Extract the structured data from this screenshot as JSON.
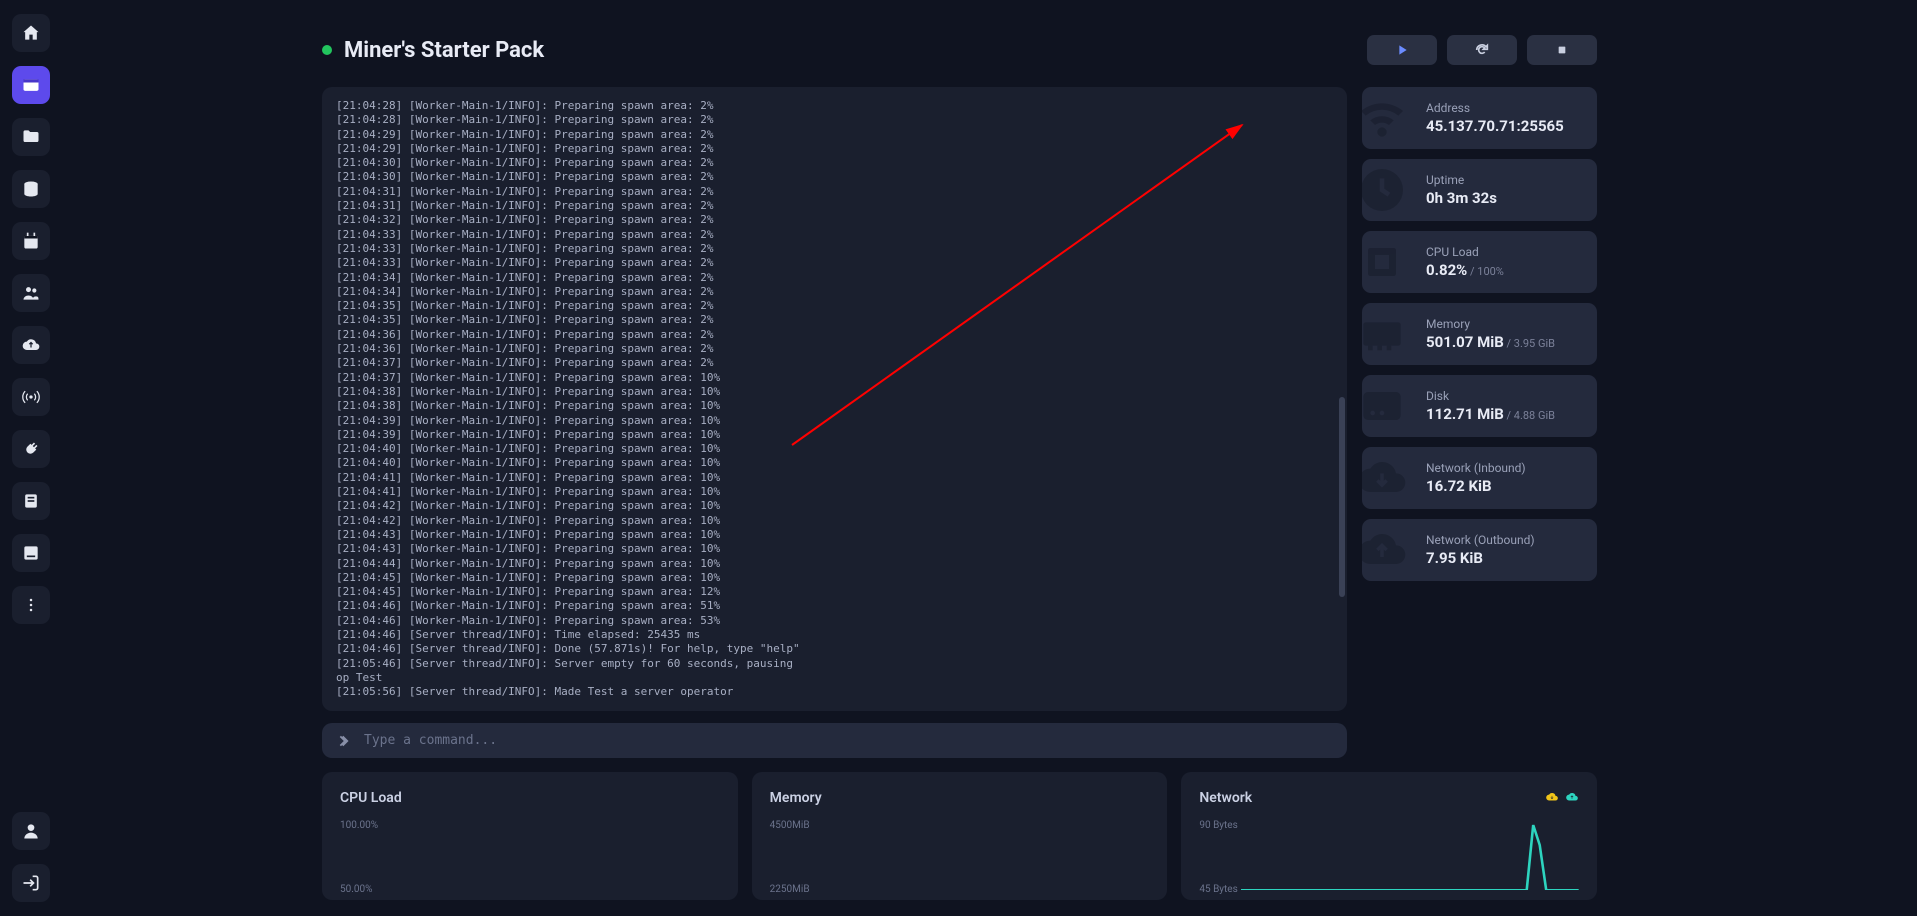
{
  "server": {
    "title": "Miner's Starter Pack",
    "status": "online"
  },
  "command": {
    "placeholder": "Type a command..."
  },
  "stats": [
    {
      "label": "Address",
      "value": "45.137.70.71:25565",
      "sub": ""
    },
    {
      "label": "Uptime",
      "value": "0h 3m 32s",
      "sub": ""
    },
    {
      "label": "CPU Load",
      "value": "0.82%",
      "sub": " / 100%"
    },
    {
      "label": "Memory",
      "value": "501.07 MiB",
      "sub": " / 3.95 GiB"
    },
    {
      "label": "Disk",
      "value": "112.71 MiB",
      "sub": " / 4.88 GiB"
    },
    {
      "label": "Network (Inbound)",
      "value": "16.72 KiB",
      "sub": ""
    },
    {
      "label": "Network (Outbound)",
      "value": "7.95 KiB",
      "sub": ""
    }
  ],
  "charts": {
    "cpu": {
      "title": "CPU Load",
      "tick_top": "100.00%",
      "tick_bot": "50.00%"
    },
    "mem": {
      "title": "Memory",
      "tick_top": "4500MiB",
      "tick_bot": "2250MiB"
    },
    "net": {
      "title": "Network",
      "tick_top": "90 Bytes",
      "tick_bot": "45 Bytes"
    }
  },
  "console_lines": [
    "[21:04:28] [Worker-Main-1/INFO]: Preparing spawn area: 2%",
    "[21:04:28] [Worker-Main-1/INFO]: Preparing spawn area: 2%",
    "[21:04:29] [Worker-Main-1/INFO]: Preparing spawn area: 2%",
    "[21:04:29] [Worker-Main-1/INFO]: Preparing spawn area: 2%",
    "[21:04:30] [Worker-Main-1/INFO]: Preparing spawn area: 2%",
    "[21:04:30] [Worker-Main-1/INFO]: Preparing spawn area: 2%",
    "[21:04:31] [Worker-Main-1/INFO]: Preparing spawn area: 2%",
    "[21:04:31] [Worker-Main-1/INFO]: Preparing spawn area: 2%",
    "[21:04:32] [Worker-Main-1/INFO]: Preparing spawn area: 2%",
    "[21:04:33] [Worker-Main-1/INFO]: Preparing spawn area: 2%",
    "[21:04:33] [Worker-Main-1/INFO]: Preparing spawn area: 2%",
    "[21:04:33] [Worker-Main-1/INFO]: Preparing spawn area: 2%",
    "[21:04:34] [Worker-Main-1/INFO]: Preparing spawn area: 2%",
    "[21:04:34] [Worker-Main-1/INFO]: Preparing spawn area: 2%",
    "[21:04:35] [Worker-Main-1/INFO]: Preparing spawn area: 2%",
    "[21:04:35] [Worker-Main-1/INFO]: Preparing spawn area: 2%",
    "[21:04:36] [Worker-Main-1/INFO]: Preparing spawn area: 2%",
    "[21:04:36] [Worker-Main-1/INFO]: Preparing spawn area: 2%",
    "[21:04:37] [Worker-Main-1/INFO]: Preparing spawn area: 2%",
    "[21:04:37] [Worker-Main-1/INFO]: Preparing spawn area: 10%",
    "[21:04:38] [Worker-Main-1/INFO]: Preparing spawn area: 10%",
    "[21:04:38] [Worker-Main-1/INFO]: Preparing spawn area: 10%",
    "[21:04:39] [Worker-Main-1/INFO]: Preparing spawn area: 10%",
    "[21:04:39] [Worker-Main-1/INFO]: Preparing spawn area: 10%",
    "[21:04:40] [Worker-Main-1/INFO]: Preparing spawn area: 10%",
    "[21:04:40] [Worker-Main-1/INFO]: Preparing spawn area: 10%",
    "[21:04:41] [Worker-Main-1/INFO]: Preparing spawn area: 10%",
    "[21:04:41] [Worker-Main-1/INFO]: Preparing spawn area: 10%",
    "[21:04:42] [Worker-Main-1/INFO]: Preparing spawn area: 10%",
    "[21:04:42] [Worker-Main-1/INFO]: Preparing spawn area: 10%",
    "[21:04:43] [Worker-Main-1/INFO]: Preparing spawn area: 10%",
    "[21:04:43] [Worker-Main-1/INFO]: Preparing spawn area: 10%",
    "[21:04:44] [Worker-Main-1/INFO]: Preparing spawn area: 10%",
    "[21:04:45] [Worker-Main-1/INFO]: Preparing spawn area: 10%",
    "[21:04:45] [Worker-Main-1/INFO]: Preparing spawn area: 12%",
    "[21:04:46] [Worker-Main-1/INFO]: Preparing spawn area: 51%",
    "[21:04:46] [Worker-Main-1/INFO]: Preparing spawn area: 53%",
    "[21:04:46] [Server thread/INFO]: Time elapsed: 25435 ms",
    "[21:04:46] [Server thread/INFO]: Done (57.871s)! For help, type \"help\"",
    "[21:05:46] [Server thread/INFO]: Server empty for 60 seconds, pausing",
    "op Test",
    "[21:05:56] [Server thread/INFO]: Made Test a server operator"
  ],
  "chart_data": [
    {
      "type": "line",
      "title": "CPU Load",
      "ylabel": "",
      "ylim": [
        0,
        100
      ],
      "ticks": [
        "100.00%",
        "50.00%"
      ],
      "series": [
        {
          "name": "cpu",
          "values": []
        }
      ]
    },
    {
      "type": "line",
      "title": "Memory",
      "ylabel": "MiB",
      "ylim": [
        0,
        4500
      ],
      "ticks": [
        "4500MiB",
        "2250MiB"
      ],
      "series": [
        {
          "name": "memory",
          "values": []
        }
      ]
    },
    {
      "type": "line",
      "title": "Network",
      "ylabel": "Bytes",
      "ylim": [
        0,
        90
      ],
      "ticks": [
        "90 Bytes",
        "45 Bytes"
      ],
      "series": [
        {
          "name": "inbound",
          "values": [
            0,
            0,
            0,
            0,
            0,
            0,
            0,
            0,
            0,
            0,
            0,
            0,
            0,
            0,
            0,
            0,
            0,
            0,
            0,
            0,
            0,
            0,
            90,
            60,
            0,
            0
          ]
        },
        {
          "name": "outbound",
          "values": [
            0,
            0,
            0,
            0,
            0,
            0,
            0,
            0,
            0,
            0,
            0,
            0,
            0,
            0,
            0,
            0,
            0,
            0,
            0,
            0,
            0,
            0,
            0,
            0,
            0,
            0
          ]
        }
      ]
    }
  ]
}
